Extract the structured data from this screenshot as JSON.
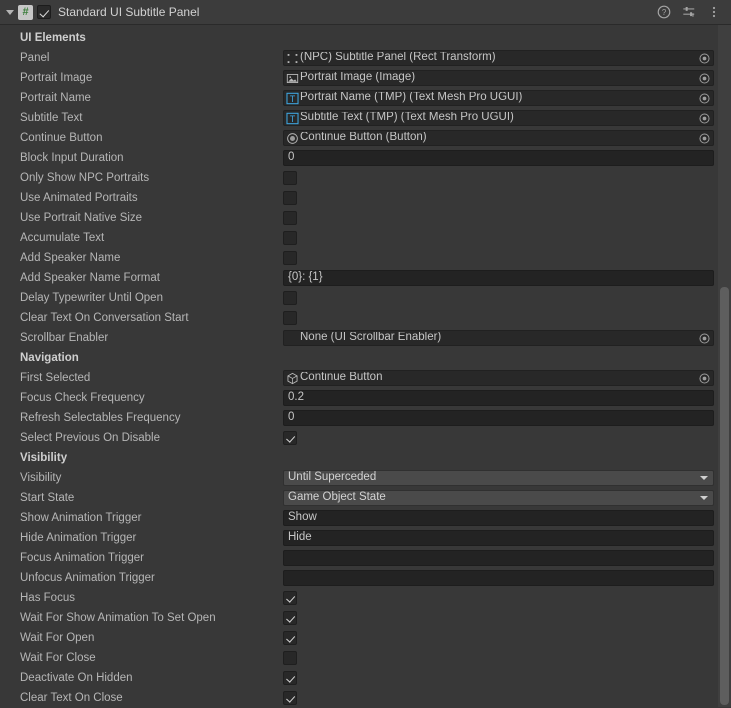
{
  "header": {
    "title": "Standard UI Subtitle Panel",
    "script_icon": "script-icon",
    "script_icon_glyph": "#",
    "enabled": true,
    "help_icon": "help-icon",
    "preset_icon": "preset-icon",
    "menu_icon": "more-menu-icon"
  },
  "sections": [
    {
      "title": "UI Elements",
      "rows": [
        {
          "label": "Panel",
          "type": "object",
          "value": "(NPC) Subtitle Panel (Rect Transform)",
          "icon": "rect-transform-icon"
        },
        {
          "label": "Portrait Image",
          "type": "object",
          "value": "Portrait Image (Image)",
          "icon": "image-component-icon"
        },
        {
          "label": "Portrait Name",
          "type": "object",
          "value": "Portrait Name (TMP) (Text Mesh Pro UGUI)",
          "icon": "textmeshpro-icon"
        },
        {
          "label": "Subtitle Text",
          "type": "object",
          "value": "Subtitle Text (TMP) (Text Mesh Pro UGUI)",
          "icon": "textmeshpro-icon"
        },
        {
          "label": "Continue Button",
          "type": "object",
          "value": "Continue Button (Button)",
          "icon": "button-component-icon"
        },
        {
          "label": "Block Input Duration",
          "type": "text",
          "value": "0"
        },
        {
          "label": "Only Show NPC Portraits",
          "type": "checkbox",
          "value": false
        },
        {
          "label": "Use Animated Portraits",
          "type": "checkbox",
          "value": false
        },
        {
          "label": "Use Portrait Native Size",
          "type": "checkbox",
          "value": false
        },
        {
          "label": "Accumulate Text",
          "type": "checkbox",
          "value": false
        },
        {
          "label": "Add Speaker Name",
          "type": "checkbox",
          "value": false
        },
        {
          "label": "Add Speaker Name Format",
          "type": "text",
          "value": "{0}: {1}"
        },
        {
          "label": "Delay Typewriter Until Open",
          "type": "checkbox",
          "value": false
        },
        {
          "label": "Clear Text On Conversation Start",
          "type": "checkbox",
          "value": false
        },
        {
          "label": "Scrollbar Enabler",
          "type": "object",
          "value": "None (UI Scrollbar Enabler)",
          "icon": "none-icon"
        }
      ]
    },
    {
      "title": "Navigation",
      "rows": [
        {
          "label": "First Selected",
          "type": "object",
          "value": "Continue Button",
          "icon": "gameobject-icon"
        },
        {
          "label": "Focus Check Frequency",
          "type": "text",
          "value": "0.2"
        },
        {
          "label": "Refresh Selectables Frequency",
          "type": "text",
          "value": "0"
        },
        {
          "label": "Select Previous On Disable",
          "type": "checkbox",
          "value": true
        }
      ]
    },
    {
      "title": "Visibility",
      "rows": [
        {
          "label": "Visibility",
          "type": "dropdown",
          "value": "Until Superceded"
        },
        {
          "label": "Start State",
          "type": "dropdown",
          "value": "Game Object State"
        },
        {
          "label": "Show Animation Trigger",
          "type": "text",
          "value": "Show"
        },
        {
          "label": "Hide Animation Trigger",
          "type": "text",
          "value": "Hide"
        },
        {
          "label": "Focus Animation Trigger",
          "type": "text",
          "value": ""
        },
        {
          "label": "Unfocus Animation Trigger",
          "type": "text",
          "value": ""
        },
        {
          "label": "Has Focus",
          "type": "checkbox",
          "value": true
        },
        {
          "label": "Wait For Show Animation To Set Open",
          "type": "checkbox",
          "value": true
        },
        {
          "label": "Wait For Open",
          "type": "checkbox",
          "value": true
        },
        {
          "label": "Wait For Close",
          "type": "checkbox",
          "value": false
        },
        {
          "label": "Deactivate On Hidden",
          "type": "checkbox",
          "value": true
        },
        {
          "label": "Clear Text On Close",
          "type": "checkbox",
          "value": true
        }
      ]
    }
  ],
  "scrollbar": {
    "name": "vertical-scrollbar"
  },
  "colors": {
    "window_bg": "#383838",
    "header_bg": "#3c3c3c",
    "field_bg": "#232323",
    "dropdown_bg": "#4a4a4a",
    "label_text": "#b6b6b6",
    "scrollbar_thumb": "#5e5e5e"
  }
}
